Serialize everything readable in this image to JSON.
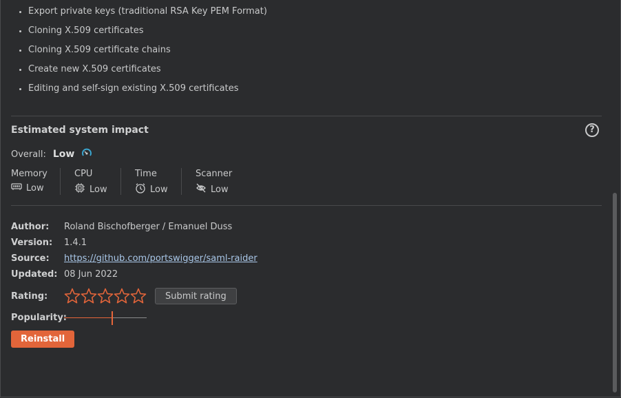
{
  "features": [
    "Export private keys (traditional RSA Key PEM Format)",
    "Cloning X.509 certificates",
    "Cloning X.509 certificate chains",
    "Create new X.509 certificates",
    "Editing and self-sign existing X.509 certificates"
  ],
  "impact": {
    "heading": "Estimated system impact",
    "help_icon": "?",
    "overall_label": "Overall:",
    "overall_value": "Low",
    "metrics": [
      {
        "name": "Memory",
        "value": "Low",
        "icon": "memory-icon"
      },
      {
        "name": "CPU",
        "value": "Low",
        "icon": "cpu-icon"
      },
      {
        "name": "Time",
        "value": "Low",
        "icon": "clock-icon"
      },
      {
        "name": "Scanner",
        "value": "Low",
        "icon": "scanner-icon"
      }
    ]
  },
  "details": {
    "author_label": "Author:",
    "author": "Roland Bischofberger / Emanuel Duss",
    "version_label": "Version:",
    "version": "1.4.1",
    "source_label": "Source:",
    "source": "https://github.com/portswigger/saml-raider",
    "updated_label": "Updated:",
    "updated": "08 Jun 2022",
    "rating_label": "Rating:",
    "rating": {
      "filled": 0,
      "max": 5
    },
    "submit_rating": "Submit rating",
    "popularity_label": "Popularity:",
    "popularity": 0.58
  },
  "reinstall": "Reinstall",
  "colors": {
    "accent": "#e2653a",
    "link": "#a9c7e8",
    "background": "#2b2c2e"
  }
}
